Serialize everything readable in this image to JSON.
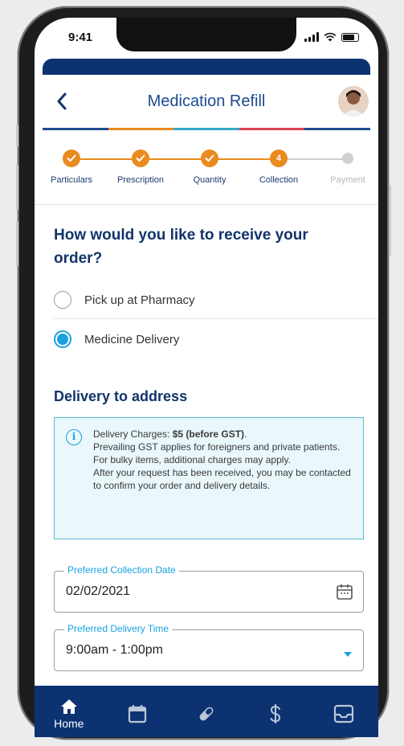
{
  "status_bar": {
    "time": "9:41"
  },
  "header": {
    "title": "Medication Refill"
  },
  "colors": {
    "primary": "#0c3272",
    "accent_orange": "#e98b1e",
    "accent_blue": "#1ba1de",
    "strip": [
      "#1c4a8f",
      "#e98b1e",
      "#37a7c9",
      "#d8424e",
      "#1c4a8f"
    ]
  },
  "steps": [
    {
      "label": "Particulars",
      "status": "done",
      "icon": "check-icon"
    },
    {
      "label": "Prescription",
      "status": "done",
      "icon": "check-icon"
    },
    {
      "label": "Quantity",
      "status": "done",
      "icon": "check-icon"
    },
    {
      "label": "Collection",
      "status": "current",
      "number": "4"
    },
    {
      "label": "Payment",
      "status": "pending"
    }
  ],
  "receive": {
    "question": "How would you like to receive your order?",
    "options": [
      {
        "label": "Pick up at Pharmacy",
        "selected": false
      },
      {
        "label": "Medicine Delivery",
        "selected": true
      }
    ]
  },
  "delivery": {
    "heading": "Delivery to address",
    "info": {
      "charge_prefix": "Delivery Charges: ",
      "charge_amount": "$5 (before GST)",
      "charge_suffix": ".",
      "line2": "Prevailing GST applies for foreigners and private patients.",
      "line3": "For bulky items, additional charges may apply.",
      "line4": "After your request has been received, you may be contacted to confirm your order and delivery details."
    },
    "date_field": {
      "label": "Preferred Collection Date",
      "value": "02/02/2021"
    },
    "time_field": {
      "label": "Preferred Delivery Time",
      "value": "9:00am - 1:00pm"
    }
  },
  "bottom_nav": [
    {
      "name": "home",
      "label": "Home",
      "icon": "home-icon",
      "active": true
    },
    {
      "name": "calendar",
      "label": "",
      "icon": "calendar-icon",
      "active": false
    },
    {
      "name": "medication",
      "label": "",
      "icon": "pill-icon",
      "active": false
    },
    {
      "name": "billing",
      "label": "",
      "icon": "dollar-icon",
      "active": false
    },
    {
      "name": "inbox",
      "label": "",
      "icon": "inbox-icon",
      "active": false
    }
  ]
}
